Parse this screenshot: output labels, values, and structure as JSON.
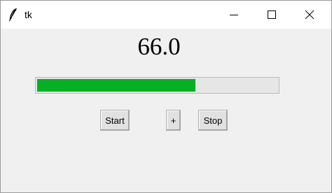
{
  "window": {
    "title": "tk",
    "icon": "feather-icon",
    "controls": [
      "minimize-icon",
      "maximize-icon",
      "close-icon"
    ]
  },
  "display": {
    "value": "66.0"
  },
  "progress": {
    "value": 66.0,
    "max": 100,
    "fill_color": "#06b025"
  },
  "buttons": {
    "start_label": "Start",
    "plus_label": "+",
    "stop_label": "Stop"
  }
}
